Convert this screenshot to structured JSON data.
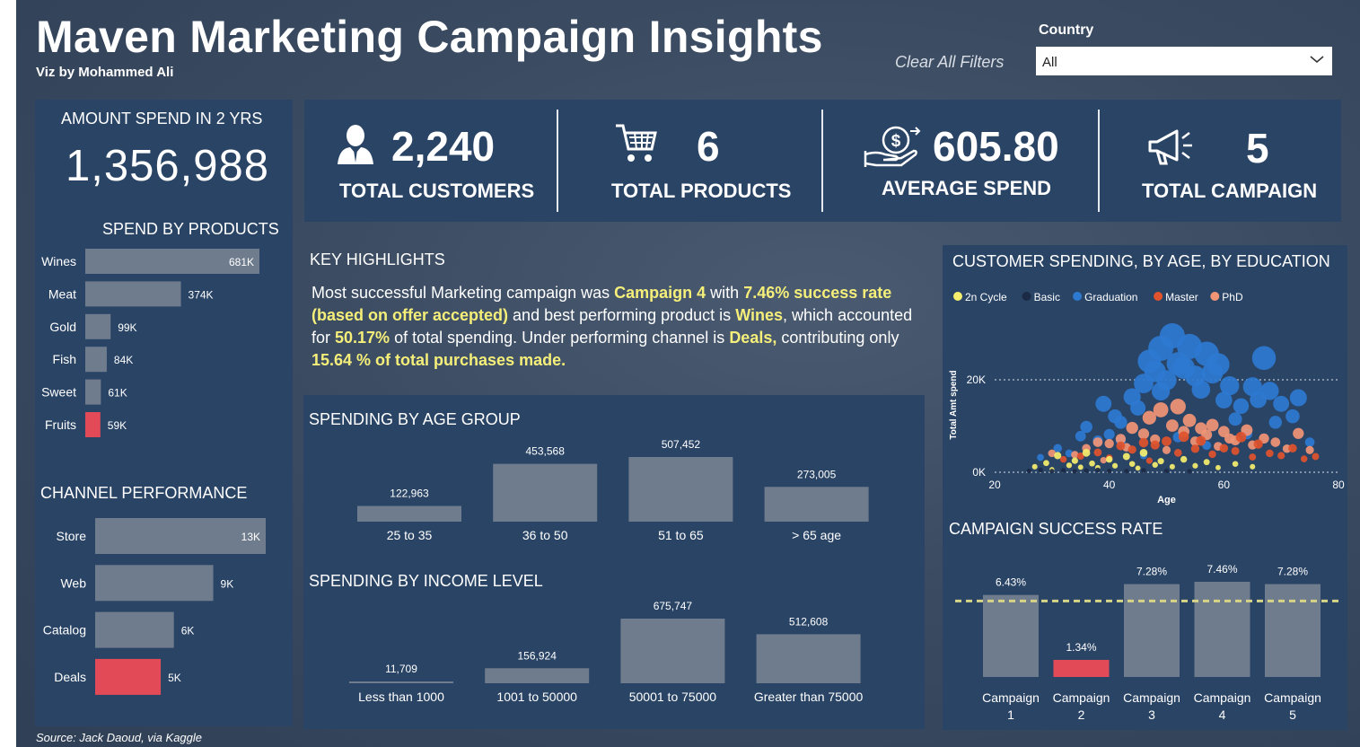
{
  "header": {
    "title": "Maven Marketing Campaign Insights",
    "subtitle": "Viz by Mohammed Ali",
    "clear_filters": "Clear All Filters",
    "country_label": "Country",
    "country_value": "All"
  },
  "amount_spend": {
    "label": "AMOUNT SPEND IN 2 YRS",
    "value": "1,356,988"
  },
  "kpis": {
    "customers": {
      "value": "2,240",
      "label": "TOTAL CUSTOMERS",
      "icon": "person-icon"
    },
    "products": {
      "value": "6",
      "label": "TOTAL PRODUCTS",
      "icon": "cart-icon"
    },
    "average": {
      "value": "605.80",
      "label": "AVERAGE SPEND",
      "icon": "money-hand-icon"
    },
    "campaign": {
      "value": "5",
      "label": "TOTAL CAMPAIGN",
      "icon": "megaphone-icon"
    }
  },
  "highlights": {
    "title": "KEY HIGHLIGHTS",
    "p1": "Most successful Marketing campaign was ",
    "b1": "Campaign 4",
    "p2": " with ",
    "b2": "7.46% success rate (based on offer accepted)",
    "p3": " and best performing product is ",
    "b3": "Wines",
    "p4": ", which accounted for  ",
    "b4": "50.17%",
    "p5": " of total spending. Under performing channel is ",
    "b5": "Deals,",
    "p6": " contributing only ",
    "b6": "15.64 % of total purchases made."
  },
  "colors": {
    "bar": "#6f7c8d",
    "highlight": "#e24a58",
    "panel": "#2a4466",
    "accent_text": "#f5ef7a",
    "2n Cycle": "#f6ef6e",
    "Basic": "#1b2a45",
    "Graduation": "#2e7ad1",
    "Master": "#e0532d",
    "PhD": "#f29575"
  },
  "source": "Source: Jack Daoud, via Kaggle",
  "chart_data": [
    {
      "id": "spend_by_products",
      "type": "bar",
      "orientation": "horizontal",
      "title": "SPEND BY PRODUCTS",
      "categories": [
        "Wines",
        "Meat",
        "Gold",
        "Fish",
        "Sweet",
        "Fruits"
      ],
      "values": [
        681000,
        374000,
        99000,
        84000,
        61000,
        59000
      ],
      "labels": [
        "681K",
        "374K",
        "99K",
        "84K",
        "61K",
        "59K"
      ],
      "highlight": "Fruits"
    },
    {
      "id": "channel_performance",
      "type": "bar",
      "orientation": "horizontal",
      "title": "CHANNEL PERFORMANCE",
      "categories": [
        "Store",
        "Web",
        "Catalog",
        "Deals"
      ],
      "values": [
        13000,
        9000,
        6000,
        5000
      ],
      "labels": [
        "13K",
        "9K",
        "6K",
        "5K"
      ],
      "highlight": "Deals"
    },
    {
      "id": "spend_by_age",
      "type": "bar",
      "title": "SPENDING BY AGE GROUP",
      "categories": [
        "25 to 35",
        "36 to 50",
        "51 to 65",
        "> 65 age"
      ],
      "values": [
        122963,
        453568,
        507452,
        273005
      ],
      "labels": [
        "122,963",
        "453,568",
        "507,452",
        "273,005"
      ]
    },
    {
      "id": "spend_by_income",
      "type": "bar",
      "title": "SPENDING BY INCOME LEVEL",
      "categories": [
        "Less than 1000",
        "1001 to 50000",
        "50001 to 75000",
        "Greater than 75000"
      ],
      "values": [
        11709,
        156924,
        675747,
        512608
      ],
      "labels": [
        "11,709",
        "156,924",
        "675,747",
        "512,608"
      ]
    },
    {
      "id": "customer_spending",
      "type": "scatter",
      "title": "CUSTOMER SPENDING, BY AGE, BY EDUCATION",
      "xlabel": "Age",
      "ylabel": "Total Amt spend",
      "xlim": [
        20,
        80
      ],
      "ylim": [
        0,
        33000
      ],
      "xticks": [
        "20",
        "40",
        "60",
        "80"
      ],
      "yticks": [
        {
          "v": 0,
          "label": "0K"
        },
        {
          "v": 20000,
          "label": "20K"
        }
      ],
      "legend": [
        "2n Cycle",
        "Basic",
        "Graduation",
        "Master",
        "PhD"
      ],
      "legend_position": "top",
      "series": [
        {
          "name": "Graduation",
          "points": [
            [
              28,
              3200
            ],
            [
              31,
              5200
            ],
            [
              33,
              4100
            ],
            [
              35,
              7800
            ],
            [
              36,
              9800
            ],
            [
              38,
              6900
            ],
            [
              39,
              14800
            ],
            [
              40,
              8200
            ],
            [
              41,
              12100
            ],
            [
              42,
              10800
            ],
            [
              44,
              16300
            ],
            [
              45,
              13900
            ],
            [
              46,
              19200
            ],
            [
              47,
              24000
            ],
            [
              48,
              21800
            ],
            [
              49,
              26800
            ],
            [
              49,
              17500
            ],
            [
              50,
              19900
            ],
            [
              51,
              29500
            ],
            [
              52,
              23500
            ],
            [
              53,
              22600
            ],
            [
              54,
              27200
            ],
            [
              55,
              20800
            ],
            [
              56,
              17900
            ],
            [
              57,
              25600
            ],
            [
              58,
              21500
            ],
            [
              59,
              23300
            ],
            [
              60,
              15600
            ],
            [
              61,
              18700
            ],
            [
              62,
              11500
            ],
            [
              63,
              14300
            ],
            [
              65,
              18500
            ],
            [
              66,
              15700
            ],
            [
              67,
              24700
            ],
            [
              68,
              17600
            ],
            [
              69,
              10800
            ],
            [
              70,
              14800
            ],
            [
              72,
              12100
            ],
            [
              73,
              16100
            ],
            [
              75,
              6500
            ],
            [
              42,
              6800
            ],
            [
              46,
              3600
            ],
            [
              52,
              7600
            ],
            [
              57,
              5800
            ],
            [
              64,
              8300
            ]
          ]
        },
        {
          "name": "PhD",
          "points": [
            [
              30,
              4100
            ],
            [
              34,
              3800
            ],
            [
              36,
              5200
            ],
            [
              38,
              6500
            ],
            [
              39,
              2600
            ],
            [
              40,
              6200
            ],
            [
              42,
              7200
            ],
            [
              43,
              5400
            ],
            [
              44,
              9600
            ],
            [
              46,
              8300
            ],
            [
              47,
              11800
            ],
            [
              48,
              7100
            ],
            [
              49,
              13500
            ],
            [
              50,
              4800
            ],
            [
              51,
              10100
            ],
            [
              52,
              14200
            ],
            [
              53,
              8800
            ],
            [
              54,
              11200
            ],
            [
              55,
              6700
            ],
            [
              56,
              9500
            ],
            [
              57,
              8100
            ],
            [
              58,
              10200
            ],
            [
              59,
              5600
            ],
            [
              60,
              8800
            ],
            [
              61,
              7300
            ],
            [
              62,
              6900
            ],
            [
              64,
              9100
            ],
            [
              65,
              5900
            ],
            [
              67,
              7300
            ],
            [
              69,
              6500
            ],
            [
              71,
              5100
            ],
            [
              73,
              8400
            ],
            [
              75,
              4800
            ]
          ]
        },
        {
          "name": "Master",
          "points": [
            [
              32,
              2800
            ],
            [
              35,
              3500
            ],
            [
              38,
              4300
            ],
            [
              40,
              3100
            ],
            [
              42,
              5700
            ],
            [
              44,
              4900
            ],
            [
              46,
              6400
            ],
            [
              47,
              2500
            ],
            [
              48,
              5900
            ],
            [
              50,
              6700
            ],
            [
              52,
              4200
            ],
            [
              53,
              7700
            ],
            [
              55,
              5100
            ],
            [
              56,
              6800
            ],
            [
              58,
              3900
            ],
            [
              60,
              5200
            ],
            [
              62,
              4600
            ],
            [
              63,
              7600
            ],
            [
              65,
              3300
            ],
            [
              66,
              6100
            ],
            [
              68,
              4100
            ],
            [
              70,
              3600
            ],
            [
              72,
              5200
            ],
            [
              74,
              2900
            ],
            [
              76,
              3400
            ]
          ]
        },
        {
          "name": "2n Cycle",
          "points": [
            [
              27,
              1200
            ],
            [
              29,
              2000
            ],
            [
              30,
              600
            ],
            [
              31,
              3600
            ],
            [
              33,
              1500
            ],
            [
              34,
              2500
            ],
            [
              35,
              1100
            ],
            [
              36,
              4200
            ],
            [
              37,
              1900
            ],
            [
              38,
              1000
            ],
            [
              40,
              2800
            ],
            [
              41,
              1400
            ],
            [
              43,
              3400
            ],
            [
              44,
              1800
            ],
            [
              45,
              900
            ],
            [
              46,
              4200
            ],
            [
              48,
              1600
            ],
            [
              49,
              2400
            ],
            [
              51,
              1200
            ],
            [
              53,
              2800
            ],
            [
              55,
              1400
            ],
            [
              57,
              2200
            ],
            [
              59,
              1000
            ],
            [
              62,
              1800
            ],
            [
              65,
              1200
            ]
          ]
        },
        {
          "name": "Basic",
          "points": [
            [
              26,
              300
            ],
            [
              28,
              500
            ],
            [
              30,
              250
            ],
            [
              32,
              400
            ],
            [
              34,
              200
            ],
            [
              36,
              350
            ],
            [
              38,
              500
            ],
            [
              40,
              300
            ],
            [
              43,
              250
            ],
            [
              46,
              400
            ],
            [
              50,
              300
            ],
            [
              54,
              200
            ]
          ]
        }
      ]
    },
    {
      "id": "campaign_success",
      "type": "bar",
      "title": "CAMPAIGN SUCCESS RATE",
      "categories": [
        "Campaign 1",
        "Campaign 2",
        "Campaign 3",
        "Campaign 4",
        "Campaign 5"
      ],
      "values": [
        6.43,
        1.34,
        7.28,
        7.46,
        7.28
      ],
      "labels": [
        "6.43%",
        "1.34%",
        "7.28%",
        "7.46%",
        "7.28%"
      ],
      "highlight": "Campaign 2",
      "average_line": true
    }
  ]
}
